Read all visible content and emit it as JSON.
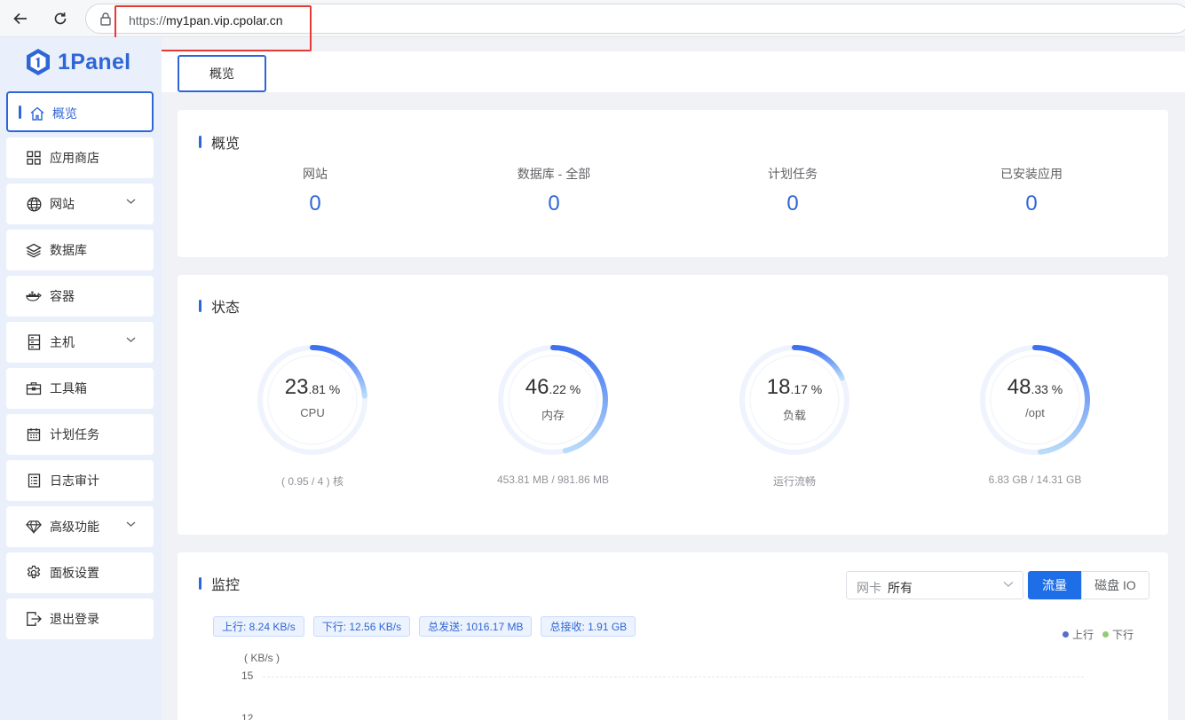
{
  "browser": {
    "url_scheme": "https://",
    "url_host": "my1pan.vip.cpolar.cn"
  },
  "sidebar": {
    "logo_text": "1Panel",
    "items": [
      {
        "label": "概览",
        "icon": "home-icon"
      },
      {
        "label": "应用商店",
        "icon": "grid-icon"
      },
      {
        "label": "网站",
        "icon": "globe-icon"
      },
      {
        "label": "数据库",
        "icon": "layers-icon"
      },
      {
        "label": "容器",
        "icon": "docker-icon"
      },
      {
        "label": "主机",
        "icon": "server-icon"
      },
      {
        "label": "工具箱",
        "icon": "toolbox-icon"
      },
      {
        "label": "计划任务",
        "icon": "calendar-icon"
      },
      {
        "label": "日志审计",
        "icon": "log-icon"
      },
      {
        "label": "高级功能",
        "icon": "diamond-icon"
      },
      {
        "label": "面板设置",
        "icon": "gear-icon"
      },
      {
        "label": "退出登录",
        "icon": "logout-icon"
      }
    ]
  },
  "tabs": {
    "active": "概览"
  },
  "overview": {
    "title": "概览",
    "stats": [
      {
        "label": "网站",
        "value": "0"
      },
      {
        "label": "数据库 - 全部",
        "value": "0"
      },
      {
        "label": "计划任务",
        "value": "0"
      },
      {
        "label": "已安装应用",
        "value": "0"
      }
    ]
  },
  "status": {
    "title": "状态",
    "gauges": [
      {
        "int": "23",
        "dec": ".81 %",
        "label": "CPU",
        "sub": "( 0.95 / 4 ) 核",
        "percent": 23.81
      },
      {
        "int": "46",
        "dec": ".22 %",
        "label": "内存",
        "sub": "453.81 MB / 981.86 MB",
        "percent": 46.22
      },
      {
        "int": "18",
        "dec": ".17 %",
        "label": "负载",
        "sub": "运行流畅",
        "percent": 18.17
      },
      {
        "int": "48",
        "dec": ".33 %",
        "label": "/opt",
        "sub": "6.83 GB / 14.31 GB",
        "percent": 48.33
      }
    ],
    "colors": {
      "start": "#3d6ff0",
      "end": "#b9dcf9",
      "track": "#eef3fd"
    }
  },
  "monitor": {
    "title": "监控",
    "select_prefix": "网卡",
    "select_value": "所有",
    "btn_traffic": "流量",
    "btn_disk": "磁盘 IO",
    "tags": {
      "up": "上行: 8.24 KB/s",
      "down": "下行: 12.56 KB/s",
      "sent": "总发送: 1016.17 MB",
      "recv": "总接收: 1.91 GB"
    },
    "legend": {
      "up": "上行",
      "down": "下行",
      "up_color": "#5470c6",
      "down_color": "#91cc75"
    },
    "unit": "( KB/s )",
    "ticks": [
      "15",
      "12"
    ]
  }
}
